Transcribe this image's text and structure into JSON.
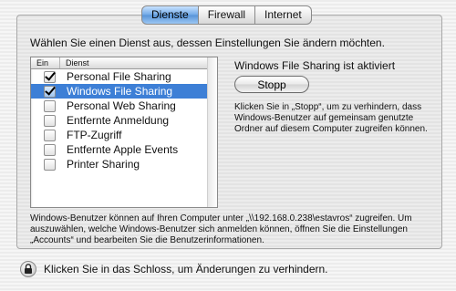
{
  "tabs": [
    {
      "label": "Dienste",
      "active": true
    },
    {
      "label": "Firewall",
      "active": false
    },
    {
      "label": "Internet",
      "active": false
    }
  ],
  "instruction": "Wählen Sie einen Dienst aus, dessen Einstellungen Sie ändern möchten.",
  "services_table": {
    "columns": [
      "Ein",
      "Dienst"
    ],
    "rows": [
      {
        "enabled": true,
        "label": "Personal File Sharing",
        "selected": false
      },
      {
        "enabled": true,
        "label": "Windows File Sharing",
        "selected": true
      },
      {
        "enabled": false,
        "label": "Personal Web Sharing",
        "selected": false
      },
      {
        "enabled": false,
        "label": "Entfernte Anmeldung",
        "selected": false
      },
      {
        "enabled": false,
        "label": "FTP-Zugriff",
        "selected": false
      },
      {
        "enabled": false,
        "label": "Entfernte Apple Events",
        "selected": false
      },
      {
        "enabled": false,
        "label": "Printer Sharing",
        "selected": false
      }
    ]
  },
  "detail": {
    "status": "Windows File Sharing ist aktiviert",
    "stop_button": "Stopp",
    "help": "Klicken Sie in „Stopp“, um zu verhindern, dass Windows-Benutzer auf gemeinsam genutzte Ordner auf diesem Computer zugreifen können."
  },
  "info_text": "Windows-Benutzer können auf Ihren Computer unter „\\\\192.168.0.238\\estavros“ zugreifen. Um auszuwählen, welche Windows-Benutzer sich anmelden können, öffnen Sie die Einstellungen „Accounts“ und bearbeiten Sie die Benutzerinformationen.",
  "lock_text": "Klicken Sie in das Schloss, um Änderungen zu verhindern.",
  "colors": {
    "selection": "#3d7fd6",
    "accent": "#5793d8"
  }
}
